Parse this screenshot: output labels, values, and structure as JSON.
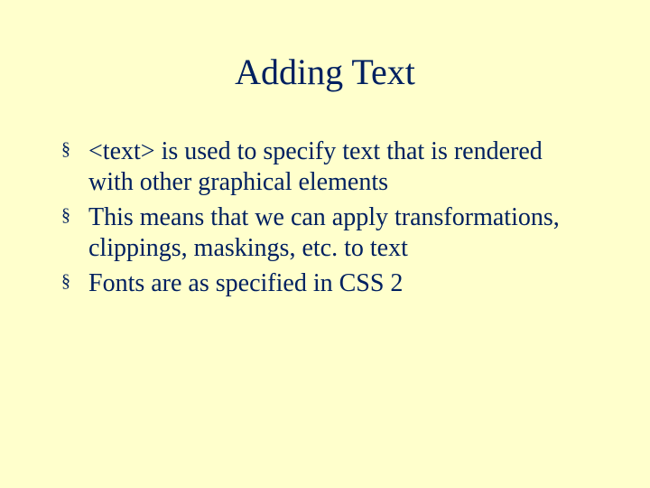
{
  "slide": {
    "title": "Adding Text",
    "bullet_glyph": "§",
    "bullets": [
      "<text> is used to specify text that is rendered with other graphical elements",
      "This means that we can apply transformations, clippings, maskings, etc. to text",
      "Fonts are as specified in CSS 2"
    ]
  }
}
